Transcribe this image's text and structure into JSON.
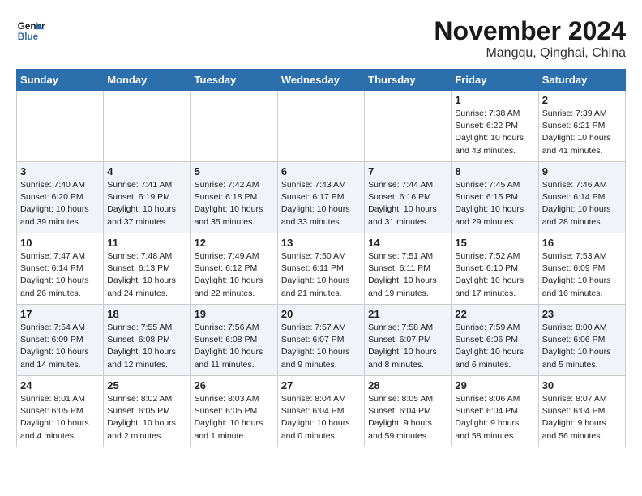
{
  "header": {
    "logo_line1": "General",
    "logo_line2": "Blue",
    "month": "November 2024",
    "location": "Mangqu, Qinghai, China"
  },
  "days_of_week": [
    "Sunday",
    "Monday",
    "Tuesday",
    "Wednesday",
    "Thursday",
    "Friday",
    "Saturday"
  ],
  "weeks": [
    [
      {
        "day": "",
        "content": ""
      },
      {
        "day": "",
        "content": ""
      },
      {
        "day": "",
        "content": ""
      },
      {
        "day": "",
        "content": ""
      },
      {
        "day": "",
        "content": ""
      },
      {
        "day": "1",
        "content": "Sunrise: 7:38 AM\nSunset: 6:22 PM\nDaylight: 10 hours and 43 minutes."
      },
      {
        "day": "2",
        "content": "Sunrise: 7:39 AM\nSunset: 6:21 PM\nDaylight: 10 hours and 41 minutes."
      }
    ],
    [
      {
        "day": "3",
        "content": "Sunrise: 7:40 AM\nSunset: 6:20 PM\nDaylight: 10 hours and 39 minutes."
      },
      {
        "day": "4",
        "content": "Sunrise: 7:41 AM\nSunset: 6:19 PM\nDaylight: 10 hours and 37 minutes."
      },
      {
        "day": "5",
        "content": "Sunrise: 7:42 AM\nSunset: 6:18 PM\nDaylight: 10 hours and 35 minutes."
      },
      {
        "day": "6",
        "content": "Sunrise: 7:43 AM\nSunset: 6:17 PM\nDaylight: 10 hours and 33 minutes."
      },
      {
        "day": "7",
        "content": "Sunrise: 7:44 AM\nSunset: 6:16 PM\nDaylight: 10 hours and 31 minutes."
      },
      {
        "day": "8",
        "content": "Sunrise: 7:45 AM\nSunset: 6:15 PM\nDaylight: 10 hours and 29 minutes."
      },
      {
        "day": "9",
        "content": "Sunrise: 7:46 AM\nSunset: 6:14 PM\nDaylight: 10 hours and 28 minutes."
      }
    ],
    [
      {
        "day": "10",
        "content": "Sunrise: 7:47 AM\nSunset: 6:14 PM\nDaylight: 10 hours and 26 minutes."
      },
      {
        "day": "11",
        "content": "Sunrise: 7:48 AM\nSunset: 6:13 PM\nDaylight: 10 hours and 24 minutes."
      },
      {
        "day": "12",
        "content": "Sunrise: 7:49 AM\nSunset: 6:12 PM\nDaylight: 10 hours and 22 minutes."
      },
      {
        "day": "13",
        "content": "Sunrise: 7:50 AM\nSunset: 6:11 PM\nDaylight: 10 hours and 21 minutes."
      },
      {
        "day": "14",
        "content": "Sunrise: 7:51 AM\nSunset: 6:11 PM\nDaylight: 10 hours and 19 minutes."
      },
      {
        "day": "15",
        "content": "Sunrise: 7:52 AM\nSunset: 6:10 PM\nDaylight: 10 hours and 17 minutes."
      },
      {
        "day": "16",
        "content": "Sunrise: 7:53 AM\nSunset: 6:09 PM\nDaylight: 10 hours and 16 minutes."
      }
    ],
    [
      {
        "day": "17",
        "content": "Sunrise: 7:54 AM\nSunset: 6:09 PM\nDaylight: 10 hours and 14 minutes."
      },
      {
        "day": "18",
        "content": "Sunrise: 7:55 AM\nSunset: 6:08 PM\nDaylight: 10 hours and 12 minutes."
      },
      {
        "day": "19",
        "content": "Sunrise: 7:56 AM\nSunset: 6:08 PM\nDaylight: 10 hours and 11 minutes."
      },
      {
        "day": "20",
        "content": "Sunrise: 7:57 AM\nSunset: 6:07 PM\nDaylight: 10 hours and 9 minutes."
      },
      {
        "day": "21",
        "content": "Sunrise: 7:58 AM\nSunset: 6:07 PM\nDaylight: 10 hours and 8 minutes."
      },
      {
        "day": "22",
        "content": "Sunrise: 7:59 AM\nSunset: 6:06 PM\nDaylight: 10 hours and 6 minutes."
      },
      {
        "day": "23",
        "content": "Sunrise: 8:00 AM\nSunset: 6:06 PM\nDaylight: 10 hours and 5 minutes."
      }
    ],
    [
      {
        "day": "24",
        "content": "Sunrise: 8:01 AM\nSunset: 6:05 PM\nDaylight: 10 hours and 4 minutes."
      },
      {
        "day": "25",
        "content": "Sunrise: 8:02 AM\nSunset: 6:05 PM\nDaylight: 10 hours and 2 minutes."
      },
      {
        "day": "26",
        "content": "Sunrise: 8:03 AM\nSunset: 6:05 PM\nDaylight: 10 hours and 1 minute."
      },
      {
        "day": "27",
        "content": "Sunrise: 8:04 AM\nSunset: 6:04 PM\nDaylight: 10 hours and 0 minutes."
      },
      {
        "day": "28",
        "content": "Sunrise: 8:05 AM\nSunset: 6:04 PM\nDaylight: 9 hours and 59 minutes."
      },
      {
        "day": "29",
        "content": "Sunrise: 8:06 AM\nSunset: 6:04 PM\nDaylight: 9 hours and 58 minutes."
      },
      {
        "day": "30",
        "content": "Sunrise: 8:07 AM\nSunset: 6:04 PM\nDaylight: 9 hours and 56 minutes."
      }
    ]
  ]
}
